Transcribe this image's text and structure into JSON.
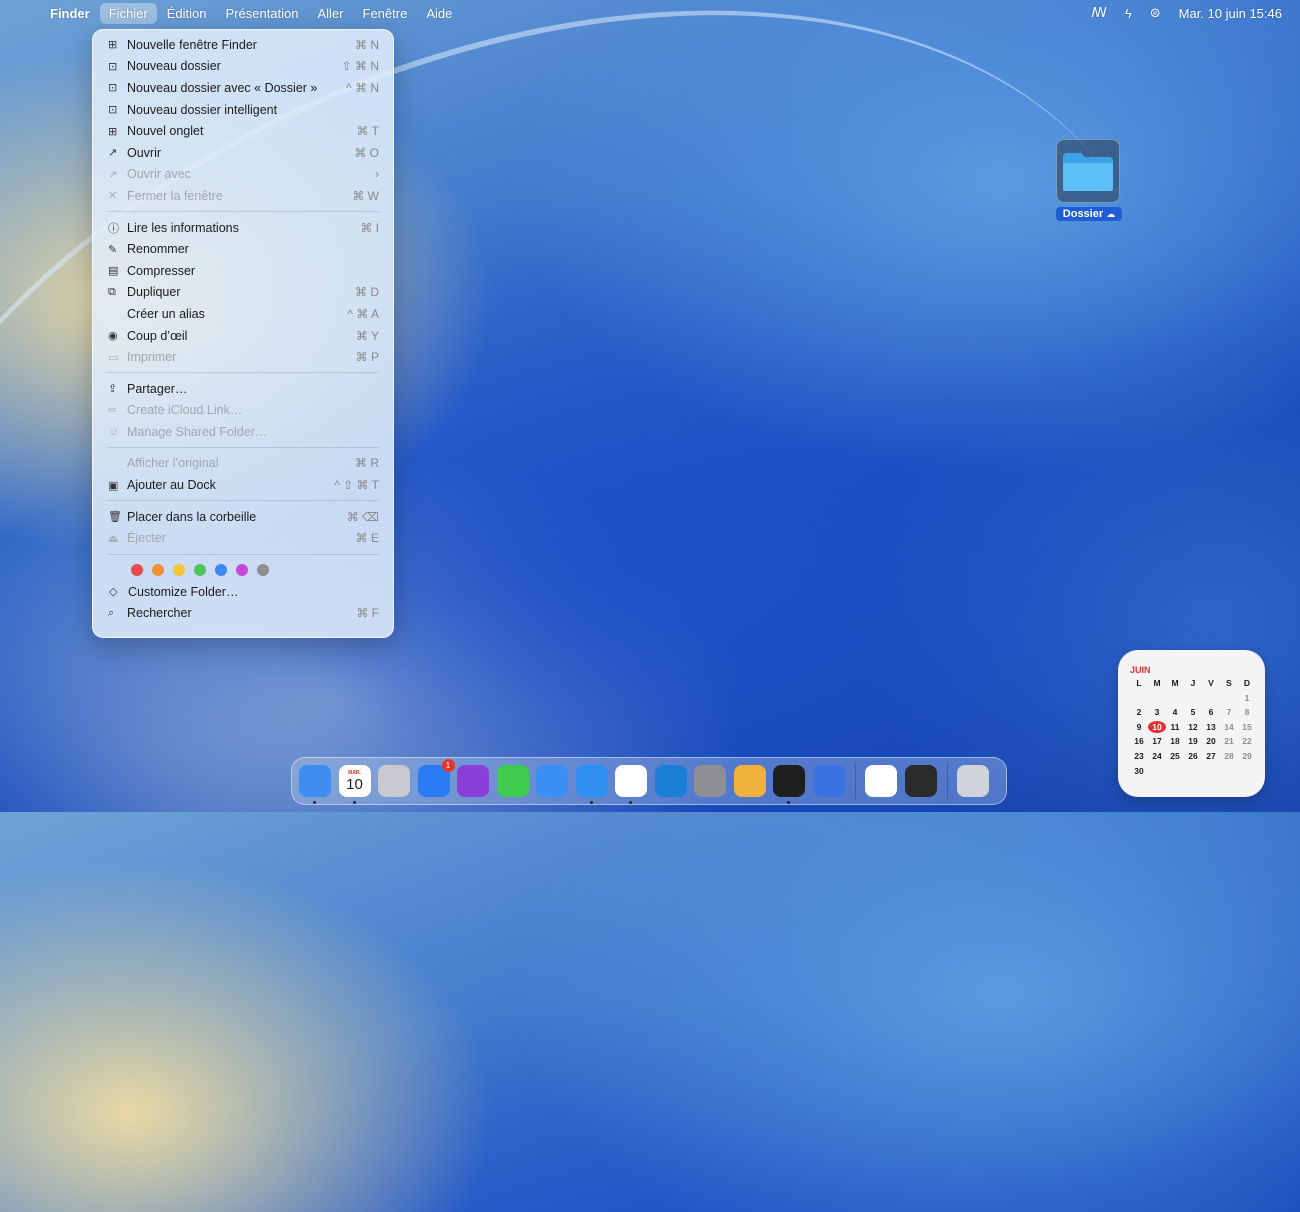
{
  "menubar": {
    "app_name": "Finder",
    "menus": [
      "Fichier",
      "Édition",
      "Présentation",
      "Aller",
      "Fenêtre",
      "Aide"
    ],
    "active_menu": "Fichier",
    "datetime": "Mar. 10 juin  15:46"
  },
  "file_menu": {
    "items": [
      {
        "label": "Nouvelle fenêtre Finder",
        "shortcut": "⌘ N",
        "icon": "new-window-icon",
        "glyph": "⊞"
      },
      {
        "label": "Nouveau dossier",
        "shortcut": "⇧ ⌘ N",
        "icon": "new-folder-icon",
        "glyph": "⊡"
      },
      {
        "label": "Nouveau dossier avec « Dossier »",
        "shortcut": "^ ⌘ N",
        "icon": "new-folder-icon",
        "glyph": "⊡"
      },
      {
        "label": "Nouveau dossier intelligent",
        "shortcut": "",
        "icon": "smart-folder-icon",
        "glyph": "⊡"
      },
      {
        "label": "Nouvel onglet",
        "shortcut": "⌘ T",
        "icon": "new-tab-icon",
        "glyph": "⊞"
      },
      {
        "label": "Ouvrir",
        "shortcut": "⌘ O",
        "icon": "open-icon",
        "glyph": "↗"
      },
      {
        "label": "Ouvrir avec",
        "shortcut": "›",
        "icon": "open-with-icon",
        "glyph": "↗",
        "disabled": true
      },
      {
        "label": "Fermer la fenêtre",
        "shortcut": "⌘ W",
        "icon": "close-icon",
        "glyph": "✕",
        "disabled": true
      },
      {
        "label": "Lire les informations",
        "shortcut": "⌘ I",
        "icon": "info-icon",
        "glyph": "ⓘ"
      },
      {
        "label": "Renommer",
        "shortcut": "",
        "icon": "pencil-icon",
        "glyph": "✎"
      },
      {
        "label": "Compresser",
        "shortcut": "",
        "icon": "archive-icon",
        "glyph": "▤"
      },
      {
        "label": "Dupliquer",
        "shortcut": "⌘ D",
        "icon": "duplicate-icon",
        "glyph": "⧉"
      },
      {
        "label": "Créer un alias",
        "shortcut": "^ ⌘ A",
        "icon": "",
        "glyph": ""
      },
      {
        "label": "Coup d’œil",
        "shortcut": "⌘ Y",
        "icon": "eye-icon",
        "glyph": "◉"
      },
      {
        "label": "Imprimer",
        "shortcut": "⌘ P",
        "icon": "printer-icon",
        "glyph": "▭",
        "disabled": true
      },
      {
        "label": "Partager…",
        "shortcut": "",
        "icon": "share-icon",
        "glyph": "⇪"
      },
      {
        "label": "Create iCloud Link…",
        "shortcut": "",
        "icon": "link-icon",
        "glyph": "∞",
        "disabled": true
      },
      {
        "label": "Manage Shared Folder…",
        "shortcut": "",
        "icon": "shared-folder-icon",
        "glyph": "☺",
        "disabled": true
      },
      {
        "label": "Afficher l’original",
        "shortcut": "⌘ R",
        "icon": "",
        "glyph": "",
        "disabled": true
      },
      {
        "label": "Ajouter au Dock",
        "shortcut": "^ ⇧ ⌘ T",
        "icon": "dock-icon",
        "glyph": "▣"
      },
      {
        "label": "Placer dans la corbeille",
        "shortcut": "⌘ ⌫",
        "icon": "trash-icon",
        "glyph": "🗑"
      },
      {
        "label": "Éjecter",
        "shortcut": "⌘ E",
        "icon": "eject-icon",
        "glyph": "⏏",
        "disabled": true
      },
      {
        "label": "Customize Folder…",
        "shortcut": "",
        "icon": "tag-icon",
        "glyph": "◇"
      },
      {
        "label": "Rechercher",
        "shortcut": "⌘ F",
        "icon": "search-icon",
        "glyph": "⌕"
      }
    ],
    "tag_colors": [
      "#e84b4b",
      "#f2913a",
      "#f4c534",
      "#4ec45a",
      "#3f87f0",
      "#c64ad8",
      "#8e8e93"
    ]
  },
  "desktop": {
    "folder_label": "Dossier"
  },
  "calendar": {
    "month": "JUIN",
    "weekdays": [
      "L",
      "M",
      "M",
      "J",
      "V",
      "S",
      "D"
    ],
    "weeks": [
      [
        "",
        "",
        "",
        "",
        "",
        "",
        "1"
      ],
      [
        "2",
        "3",
        "4",
        "5",
        "6",
        "7",
        "8"
      ],
      [
        "9",
        "10",
        "11",
        "12",
        "13",
        "14",
        "15"
      ],
      [
        "16",
        "17",
        "18",
        "19",
        "20",
        "21",
        "22"
      ],
      [
        "23",
        "24",
        "25",
        "26",
        "27",
        "28",
        "29"
      ],
      [
        "30",
        "",
        "",
        "",
        "",
        "",
        ""
      ]
    ],
    "today": "10"
  },
  "dock": {
    "calendar_icon": {
      "month": "MAR.",
      "day": "10"
    },
    "app_store_badge": "1",
    "apps": [
      {
        "name": "finder-icon",
        "color": "#3d8ef0",
        "running": true
      },
      {
        "name": "calendar-icon",
        "color": "#ffffff",
        "running": true
      },
      {
        "name": "launchpad-icon",
        "color": "#c8c8d0",
        "running": false
      },
      {
        "name": "app-store-icon",
        "color": "#2a7cf5",
        "running": false
      },
      {
        "name": "shortcuts-icon",
        "color": "#8b3fd8",
        "running": false
      },
      {
        "name": "messages-icon",
        "color": "#3fcb4e",
        "running": false
      },
      {
        "name": "mail-icon",
        "color": "#3a8ef5",
        "running": false
      },
      {
        "name": "safari-icon",
        "color": "#2f8ff0",
        "running": true
      },
      {
        "name": "notes-icon",
        "color": "#ffffff",
        "running": true
      },
      {
        "name": "vscode-icon",
        "color": "#1c7fd6",
        "running": false
      },
      {
        "name": "system-settings-icon",
        "color": "#8e8e93",
        "running": false
      },
      {
        "name": "preview-icon",
        "color": "#f0b23a",
        "running": false
      },
      {
        "name": "terminal-icon",
        "color": "#1e1e1e",
        "running": true
      },
      {
        "name": "simulator-icon",
        "color": "#3a72e0",
        "running": false
      },
      {
        "name": "writing-icon",
        "color": "#ffffff",
        "running": false
      },
      {
        "name": "media-icon",
        "color": "#2a2a2a",
        "running": false
      },
      {
        "name": "trash-bin-icon",
        "color": "#cfd4da",
        "running": false
      }
    ]
  }
}
